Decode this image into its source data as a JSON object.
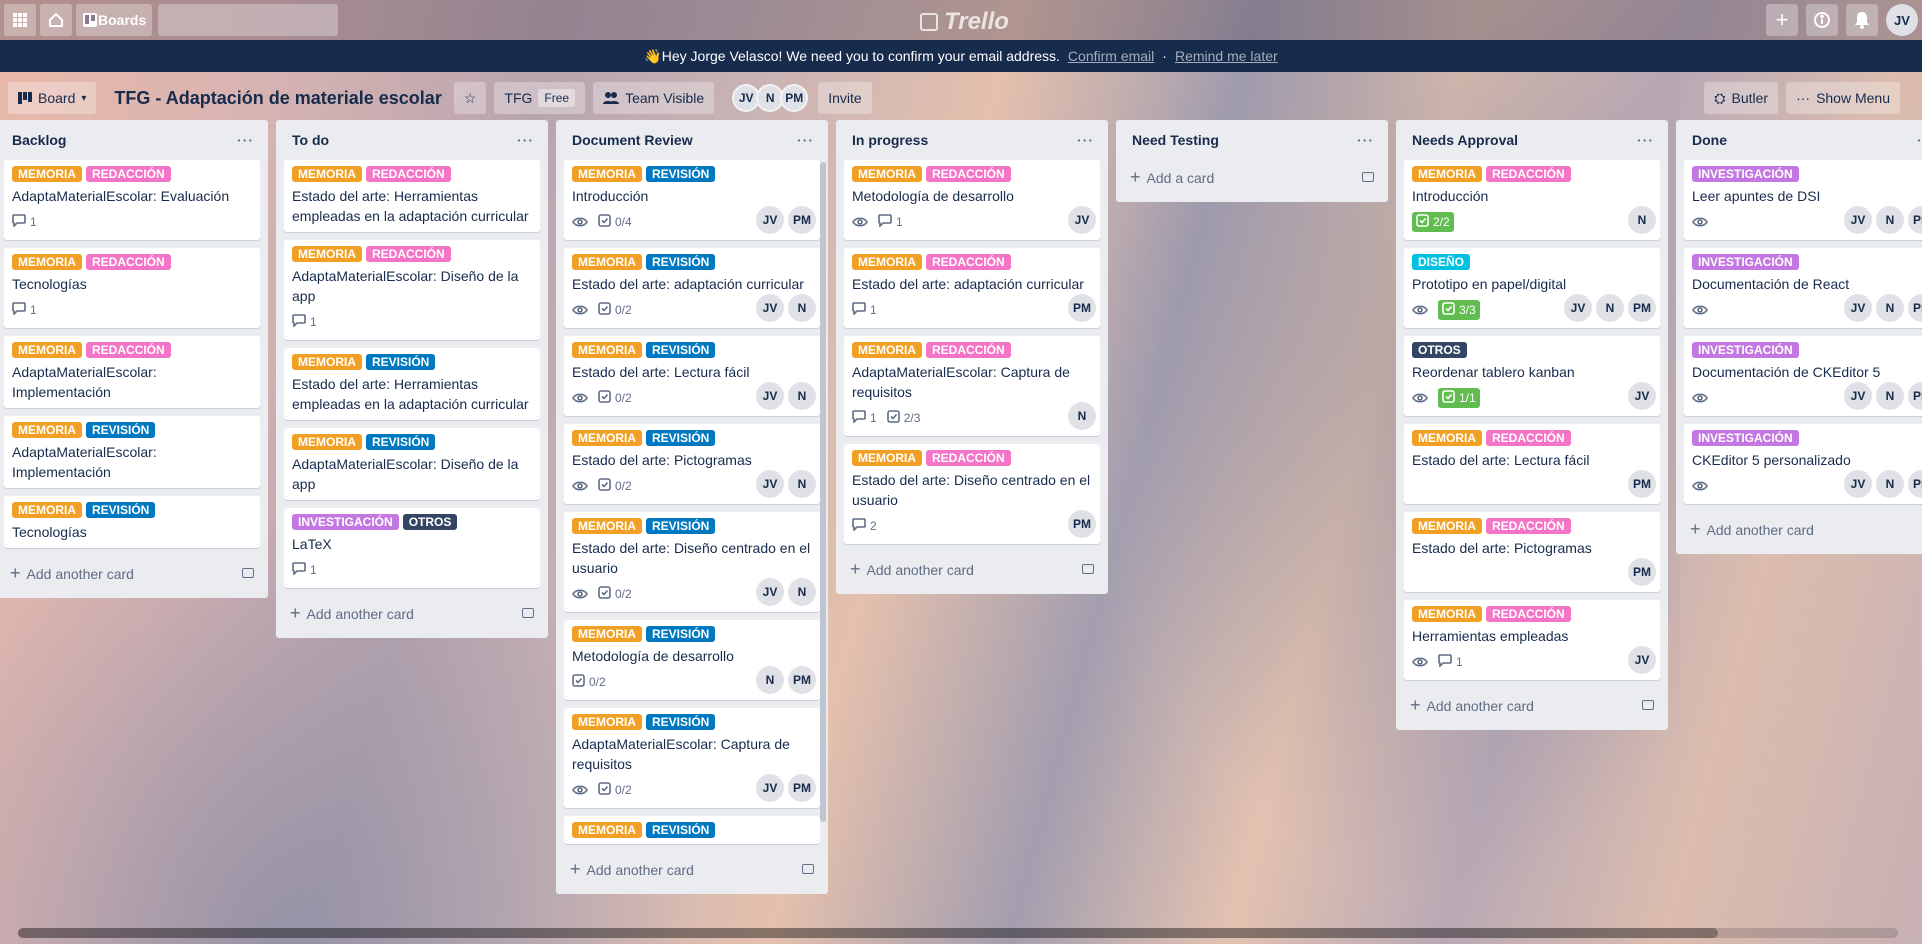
{
  "colors": {
    "MEMORIA": "#f2a024",
    "REDACCIÓN": "#f375c7",
    "REVISIÓN": "#0079bf",
    "INVESTIGACIÓN": "#c377e0",
    "OTROS": "#344563",
    "DISEÑO": "#00c2e0"
  },
  "topbar": {
    "boards_label": "Boards",
    "search_placeholder": "",
    "logo": "Trello",
    "user_initials": "JV"
  },
  "banner": {
    "text": "👋Hey Jorge Velasco! We need you to confirm your email address.",
    "confirm": "Confirm email",
    "separator": "·",
    "remind": "Remind me later"
  },
  "boardbar": {
    "view": "Board",
    "title": "TFG - Adaptación de materiale escolar",
    "workspace": "TFG",
    "plan": "Free",
    "visibility": "Team Visible",
    "members": [
      "JV",
      "N",
      "PM"
    ],
    "invite": "Invite",
    "butler": "Butler",
    "show_menu": "Show Menu"
  },
  "add_card": "Add another card",
  "add_card_first": "Add a card",
  "lists": [
    {
      "name": "Backlog",
      "cards": [
        {
          "labels": [
            "MEMORIA",
            "REDACCIÓN"
          ],
          "title": "AdaptaMaterialEscolar: Evaluación",
          "comments": "1"
        },
        {
          "labels": [
            "MEMORIA",
            "REDACCIÓN"
          ],
          "title": "Tecnologías",
          "comments": "1"
        },
        {
          "labels": [
            "MEMORIA",
            "REDACCIÓN"
          ],
          "title": "AdaptaMaterialEscolar: Implementación"
        },
        {
          "labels": [
            "MEMORIA",
            "REVISIÓN"
          ],
          "title": "AdaptaMaterialEscolar: Implementación"
        },
        {
          "labels": [
            "MEMORIA",
            "REVISIÓN"
          ],
          "title": "Tecnologías"
        }
      ]
    },
    {
      "name": "To do",
      "cards": [
        {
          "labels": [
            "MEMORIA",
            "REDACCIÓN"
          ],
          "title": "Estado del arte: Herramientas empleadas en la adaptación curricular"
        },
        {
          "labels": [
            "MEMORIA",
            "REDACCIÓN"
          ],
          "title": "AdaptaMaterialEscolar: Diseño de la app",
          "comments": "1"
        },
        {
          "labels": [
            "MEMORIA",
            "REVISIÓN"
          ],
          "title": "Estado del arte: Herramientas empleadas en la adaptación curricular"
        },
        {
          "labels": [
            "MEMORIA",
            "REVISIÓN"
          ],
          "title": "AdaptaMaterialEscolar: Diseño de la app"
        },
        {
          "labels": [
            "INVESTIGACIÓN",
            "OTROS"
          ],
          "title": "LaTeX",
          "comments": "1"
        }
      ]
    },
    {
      "name": "Document Review",
      "cards": [
        {
          "labels": [
            "MEMORIA",
            "REVISIÓN"
          ],
          "title": "Introducción",
          "watch": true,
          "checklist": "0/4",
          "members": [
            "JV",
            "PM"
          ]
        },
        {
          "labels": [
            "MEMORIA",
            "REVISIÓN"
          ],
          "title": "Estado del arte: adaptación curricular",
          "watch": true,
          "checklist": "0/2",
          "members": [
            "JV",
            "N"
          ]
        },
        {
          "labels": [
            "MEMORIA",
            "REVISIÓN"
          ],
          "title": "Estado del arte: Lectura fácil",
          "watch": true,
          "checklist": "0/2",
          "members": [
            "JV",
            "N"
          ]
        },
        {
          "labels": [
            "MEMORIA",
            "REVISIÓN"
          ],
          "title": "Estado del arte: Pictogramas",
          "watch": true,
          "checklist": "0/2",
          "members": [
            "JV",
            "N"
          ]
        },
        {
          "labels": [
            "MEMORIA",
            "REVISIÓN"
          ],
          "title": "Estado del arte: Diseño centrado en el usuario",
          "watch": true,
          "checklist": "0/2",
          "members": [
            "JV",
            "N"
          ]
        },
        {
          "labels": [
            "MEMORIA",
            "REVISIÓN"
          ],
          "title": "Metodología de desarrollo",
          "checklist": "0/2",
          "members": [
            "N",
            "PM"
          ]
        },
        {
          "labels": [
            "MEMORIA",
            "REVISIÓN"
          ],
          "title": "AdaptaMaterialEscolar: Captura de requisitos",
          "watch": true,
          "checklist": "0/2",
          "members": [
            "JV",
            "PM"
          ]
        },
        {
          "labels": [
            "MEMORIA",
            "REVISIÓN"
          ],
          "title": ""
        }
      ]
    },
    {
      "name": "In progress",
      "cards": [
        {
          "labels": [
            "MEMORIA",
            "REDACCIÓN"
          ],
          "title": "Metodología de desarrollo",
          "watch": true,
          "comments": "1",
          "members": [
            "JV"
          ]
        },
        {
          "labels": [
            "MEMORIA",
            "REDACCIÓN"
          ],
          "title": "Estado del arte: adaptación curricular",
          "comments": "1",
          "members": [
            "PM"
          ]
        },
        {
          "labels": [
            "MEMORIA",
            "REDACCIÓN"
          ],
          "title": "AdaptaMaterialEscolar: Captura de requisitos",
          "comments": "1",
          "checklist": "2/3",
          "members": [
            "N"
          ]
        },
        {
          "labels": [
            "MEMORIA",
            "REDACCIÓN"
          ],
          "title": "Estado del arte: Diseño centrado en el usuario",
          "comments": "2",
          "members": [
            "PM"
          ]
        }
      ]
    },
    {
      "name": "Need Testing",
      "cards": []
    },
    {
      "name": "Needs Approval",
      "cards": [
        {
          "labels": [
            "MEMORIA",
            "REDACCIÓN"
          ],
          "title": "Introducción",
          "checklist_done": "2/2",
          "members": [
            "N"
          ]
        },
        {
          "labels": [
            "DISEÑO"
          ],
          "title": "Prototipo en papel/digital",
          "watch": true,
          "checklist_done": "3/3",
          "members": [
            "JV",
            "N",
            "PM"
          ]
        },
        {
          "labels": [
            "OTROS"
          ],
          "title": "Reordenar tablero kanban",
          "watch": true,
          "checklist_done": "1/1",
          "members": [
            "JV"
          ]
        },
        {
          "labels": [
            "MEMORIA",
            "REDACCIÓN"
          ],
          "title": "Estado del arte: Lectura fácil",
          "members": [
            "PM"
          ]
        },
        {
          "labels": [
            "MEMORIA",
            "REDACCIÓN"
          ],
          "title": "Estado del arte: Pictogramas",
          "members": [
            "PM"
          ]
        },
        {
          "labels": [
            "MEMORIA",
            "REDACCIÓN"
          ],
          "title": "Herramientas empleadas",
          "watch": true,
          "comments": "1",
          "members": [
            "JV"
          ]
        }
      ]
    },
    {
      "name": "Done",
      "cards": [
        {
          "labels": [
            "INVESTIGACIÓN"
          ],
          "title": "Leer apuntes de DSI",
          "watch": true,
          "members": [
            "JV",
            "N",
            "PM"
          ]
        },
        {
          "labels": [
            "INVESTIGACIÓN"
          ],
          "title": "Documentación de React",
          "watch": true,
          "members": [
            "JV",
            "N",
            "PM"
          ]
        },
        {
          "labels": [
            "INVESTIGACIÓN"
          ],
          "title": "Documentación de CKEditor 5",
          "watch": true,
          "members": [
            "JV",
            "N",
            "PM"
          ]
        },
        {
          "labels": [
            "INVESTIGACIÓN"
          ],
          "title": "CKEditor 5 personalizado",
          "watch": true,
          "members": [
            "JV",
            "N",
            "PM"
          ]
        }
      ]
    }
  ]
}
